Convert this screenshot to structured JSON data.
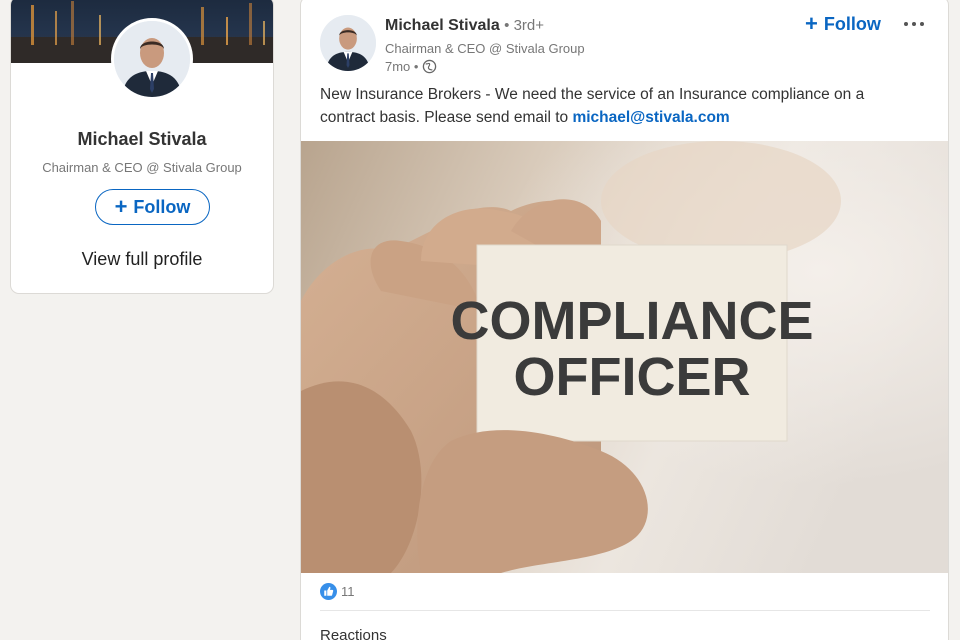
{
  "profile_card": {
    "name": "Michael Stivala",
    "headline": "Chairman & CEO @ Stivala Group",
    "follow_label": "Follow",
    "view_profile_label": "View full profile"
  },
  "post": {
    "author_name": "Michael Stivala",
    "degree": "• 3rd+",
    "headline": "Chairman & CEO @ Stivala Group",
    "time": "7mo •",
    "follow_label": "Follow",
    "text": "New Insurance Brokers - We need the service of an Insurance compliance on a contract basis. Please send email to ",
    "email": "michael@stivala.com",
    "image_text_line1": "COMPLIANCE",
    "image_text_line2": "OFFICER",
    "reaction_count": "11",
    "bottom_label": "Reactions"
  },
  "icons": [
    "plus-icon",
    "globe-icon",
    "more-icon",
    "like-icon"
  ],
  "colors": {
    "accent": "#0a66c2",
    "background": "#f3f2ef",
    "card": "#ffffff"
  }
}
